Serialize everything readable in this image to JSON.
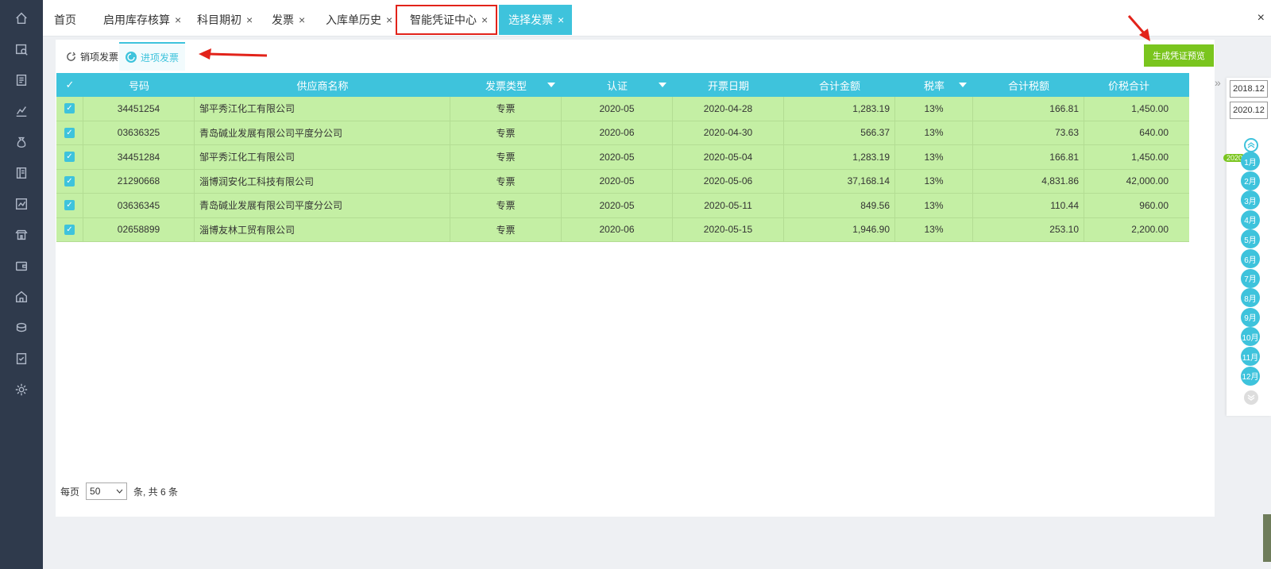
{
  "sidebar": {
    "icons": [
      "home-icon",
      "search-list-icon",
      "voucher-icon",
      "chart-icon",
      "money-bag-icon",
      "ledger-icon",
      "report-icon",
      "building-icon",
      "wallet-icon",
      "house-icon",
      "coins-icon",
      "document-check-icon",
      "gear-icon"
    ]
  },
  "tabs": [
    {
      "label": "首页",
      "closable": false
    },
    {
      "label": "启用库存核算",
      "closable": true
    },
    {
      "label": "科目期初",
      "closable": true
    },
    {
      "label": "发票",
      "closable": true
    },
    {
      "label": "入库单历史",
      "closable": true
    },
    {
      "label": "智能凭证中心",
      "closable": true
    },
    {
      "label": "选择发票",
      "closable": true
    }
  ],
  "close_glyph": "×",
  "subtabs": [
    {
      "label": "销项发票"
    },
    {
      "label": "进项发票"
    }
  ],
  "generate_button": "生成凭证预览",
  "table": {
    "check_glyph": "✓",
    "headers": [
      "号码",
      "供应商名称",
      "发票类型",
      "认证",
      "开票日期",
      "合计金额",
      "税率",
      "合计税额",
      "价税合计"
    ],
    "rows": [
      {
        "no": "34451254",
        "supplier": "邹平秀江化工有限公司",
        "type": "专票",
        "auth": "2020-05",
        "date": "2020-04-28",
        "amount": "1,283.19",
        "rate": "13%",
        "tax": "166.81",
        "total": "1,450.00"
      },
      {
        "no": "03636325",
        "supplier": "青岛碱业发展有限公司平度分公司",
        "type": "专票",
        "auth": "2020-06",
        "date": "2020-04-30",
        "amount": "566.37",
        "rate": "13%",
        "tax": "73.63",
        "total": "640.00"
      },
      {
        "no": "34451284",
        "supplier": "邹平秀江化工有限公司",
        "type": "专票",
        "auth": "2020-05",
        "date": "2020-05-04",
        "amount": "1,283.19",
        "rate": "13%",
        "tax": "166.81",
        "total": "1,450.00"
      },
      {
        "no": "21290668",
        "supplier": "淄博润安化工科技有限公司",
        "type": "专票",
        "auth": "2020-05",
        "date": "2020-05-06",
        "amount": "37,168.14",
        "rate": "13%",
        "tax": "4,831.86",
        "total": "42,000.00"
      },
      {
        "no": "03636345",
        "supplier": "青岛碱业发展有限公司平度分公司",
        "type": "专票",
        "auth": "2020-05",
        "date": "2020-05-11",
        "amount": "849.56",
        "rate": "13%",
        "tax": "110.44",
        "total": "960.00"
      },
      {
        "no": "02658899",
        "supplier": "淄博友林工贸有限公司",
        "type": "专票",
        "auth": "2020-06",
        "date": "2020-05-15",
        "amount": "1,946.90",
        "rate": "13%",
        "tax": "253.10",
        "total": "2,200.00"
      }
    ]
  },
  "pager": {
    "per_page_label": "每页",
    "page_size": "50",
    "suffix": "条, 共 6 条"
  },
  "collapse_glyph": "»",
  "date_panel": {
    "start": "2018.12",
    "end": "2020.12",
    "year": "2020",
    "months": [
      "1月",
      "2月",
      "3月",
      "4月",
      "5月",
      "6月",
      "7月",
      "8月",
      "9月",
      "10月",
      "11月",
      "12月"
    ]
  },
  "colors": {
    "sidebar": "#2f3a4c",
    "accent": "#3ec3dc",
    "row_selected": "#c4efa4",
    "button_green": "#7ac51e",
    "highlight_red": "#e2231a"
  }
}
